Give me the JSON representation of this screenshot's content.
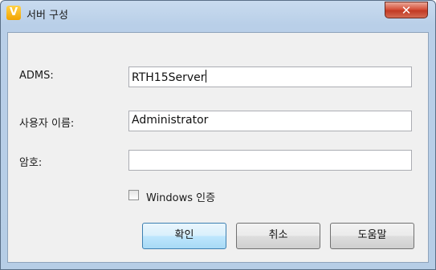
{
  "window": {
    "title": "서버 구성",
    "app_icon_letter": "V",
    "close_glyph": "✕"
  },
  "form": {
    "adms_label": "ADMS:",
    "adms_value": "RTH15Server",
    "username_label": "사용자 이름:",
    "username_value": "Administrator",
    "password_label": "암호:",
    "password_value": "",
    "windows_auth_label": "Windows 인증",
    "windows_auth_checked": false
  },
  "buttons": {
    "ok": "확인",
    "cancel": "취소",
    "help": "도움말"
  },
  "icons": {
    "app": "app-logo-icon",
    "close": "close-icon"
  }
}
